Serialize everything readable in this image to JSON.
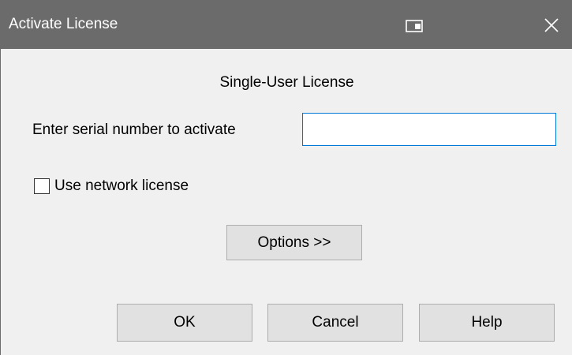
{
  "window": {
    "title": "Activate License",
    "snap_icon": "snap-layout-icon",
    "close_icon": "close-icon",
    "close_glyph": "✕"
  },
  "dialog": {
    "heading": "Single-User License",
    "serial_label": "Enter serial number to activate",
    "serial_value": "",
    "network_checkbox_label": "Use network license",
    "network_checkbox_checked": false,
    "options_button": "Options >>",
    "ok_button": "OK",
    "cancel_button": "Cancel",
    "help_button": "Help"
  },
  "colors": {
    "titlebar": "#6b6b6b",
    "focus_border": "#0078d7",
    "button_face": "#e1e1e1"
  }
}
